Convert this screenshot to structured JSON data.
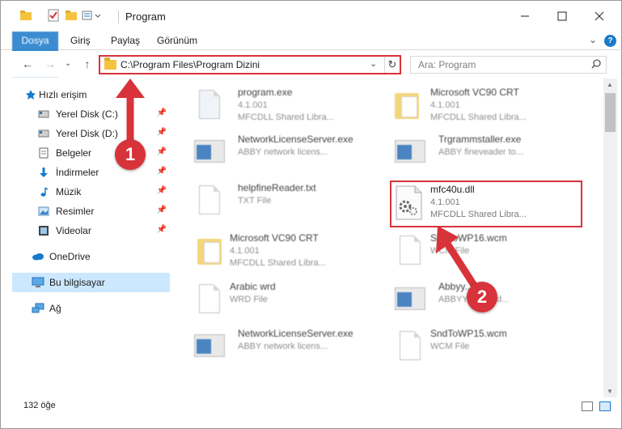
{
  "window": {
    "title": "Program"
  },
  "ribbon": {
    "tabs": [
      "Dosya",
      "Giriş",
      "Paylaş",
      "Görünüm"
    ]
  },
  "address": {
    "path": "C:\\Program Files\\Program Dizini"
  },
  "search": {
    "placeholder": "Ara: Program"
  },
  "sidebar": {
    "items": [
      {
        "label": "Hızlı erişim",
        "icon": "star-icon"
      },
      {
        "label": "Yerel Disk (C:)",
        "icon": "drive-icon"
      },
      {
        "label": "Yerel Disk (D:)",
        "icon": "drive-icon"
      },
      {
        "label": "Belgeler",
        "icon": "documents-icon"
      },
      {
        "label": "İndirmeler",
        "icon": "download-icon"
      },
      {
        "label": "Müzik",
        "icon": "music-icon"
      },
      {
        "label": "Resimler",
        "icon": "pictures-icon"
      },
      {
        "label": "Videolar",
        "icon": "video-icon"
      },
      {
        "label": "OneDrive",
        "icon": "cloud-icon"
      },
      {
        "label": "Bu bilgisayar",
        "icon": "computer-icon"
      },
      {
        "label": "Ağ",
        "icon": "network-icon"
      }
    ]
  },
  "files": [
    {
      "name": "program.exe",
      "line1": "4.1.001",
      "line2": "MFCDLL Shared Libra..."
    },
    {
      "name": "Microsoft VC90 CRT",
      "line1": "4.1.001",
      "line2": "MFCDLL Shared Libra..."
    },
    {
      "name": "NetworkLicenseServer.exe",
      "line1": "ABBY network licens..."
    },
    {
      "name": "Trgrammstaller.exe",
      "line1": "ABBY fineveader to..."
    },
    {
      "name": "helpfineReader.txt",
      "line1": "TXT File"
    },
    {
      "name": "mfc40u.dll",
      "line1": "4.1.001",
      "line2": "MFCDLL Shared Libra..."
    },
    {
      "name": "Microsoft VC90 CRT",
      "line1": "4.1.001",
      "line2": "MFCDLL Shared Libra..."
    },
    {
      "name": "SndToWP16.wcm",
      "line1": "WCM File"
    },
    {
      "name": "Arabic wrd",
      "line1": "WRD File"
    },
    {
      "name": "Abbyy...e",
      "line1": "ABBYY ... Hand..."
    },
    {
      "name": "NetworkLicenseServer.exe",
      "line1": "ABBY network licens..."
    },
    {
      "name": "SndToWP15.wcm",
      "line1": "WCM File"
    }
  ],
  "status": {
    "count": "132 öğe"
  },
  "callouts": [
    "1",
    "2"
  ],
  "colors": {
    "accent": "#1979ca",
    "highlight": "#d8333a",
    "selection": "#cce8ff"
  }
}
